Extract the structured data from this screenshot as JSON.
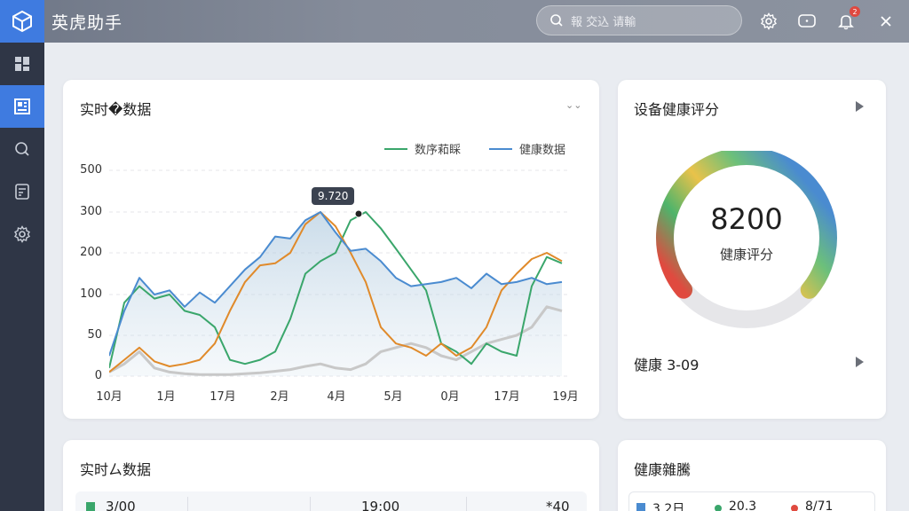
{
  "app": {
    "title": "英虎助手"
  },
  "search": {
    "placeholder": "報  交込 请輸"
  },
  "topbar": {
    "notification_count": "2"
  },
  "sidebar": {
    "items": [
      {
        "name": "dashboard",
        "icon": "grid-icon",
        "active": false
      },
      {
        "name": "reports",
        "icon": "board-icon",
        "active": true
      },
      {
        "name": "search",
        "icon": "search-icon",
        "active": false
      },
      {
        "name": "documents",
        "icon": "document-icon",
        "active": false
      },
      {
        "name": "settings",
        "icon": "gear-icon",
        "active": false
      }
    ]
  },
  "realtime_card": {
    "title": "实时�数据",
    "legend": [
      {
        "label": "数序萂睬",
        "color": "#3aa66b"
      },
      {
        "label": "健康数据",
        "color": "#4a8bd0"
      }
    ],
    "tooltip": "9.720"
  },
  "chart_data": {
    "type": "line",
    "x_ticks": [
      "10月",
      "1月",
      "17月",
      "2月",
      "4月",
      "5月",
      "0月",
      "17月",
      "19月"
    ],
    "y_ticks": [
      "500",
      "300",
      "200",
      "100",
      "50",
      "0"
    ],
    "ylim": [
      0,
      500
    ],
    "series": [
      {
        "name": "数序萂睬",
        "color": "#3aa66b",
        "values": [
          10,
          90,
          120,
          95,
          100,
          80,
          75,
          60,
          20,
          15,
          20,
          30,
          70,
          150,
          180,
          200,
          280,
          300,
          260,
          210,
          160,
          110,
          40,
          30,
          15,
          40,
          30,
          25,
          120,
          190,
          175
        ]
      },
      {
        "name": "健康数据",
        "color": "#4a8bd0",
        "values": [
          25,
          80,
          140,
          100,
          110,
          85,
          105,
          90,
          120,
          160,
          190,
          240,
          235,
          280,
          300,
          250,
          205,
          210,
          180,
          140,
          120,
          125,
          130,
          140,
          115,
          150,
          125,
          130,
          140,
          125,
          130
        ]
      },
      {
        "name": "",
        "color": "#e08a2a",
        "values": [
          5,
          20,
          35,
          18,
          12,
          15,
          20,
          40,
          80,
          130,
          170,
          175,
          200,
          270,
          300,
          265,
          200,
          130,
          60,
          40,
          35,
          25,
          40,
          25,
          35,
          60,
          110,
          150,
          185,
          200,
          180
        ]
      },
      {
        "name": "",
        "color": "#c8c8c8",
        "values": [
          5,
          15,
          30,
          10,
          5,
          3,
          2,
          2,
          2,
          3,
          4,
          6,
          8,
          12,
          15,
          10,
          8,
          15,
          30,
          35,
          40,
          35,
          25,
          20,
          30,
          40,
          45,
          50,
          60,
          85,
          80
        ]
      }
    ]
  },
  "health_card": {
    "title": "设备健康评分",
    "score": "8200",
    "score_label": "健康评分",
    "gauge_fraction": 0.72,
    "footer_label": "健康 3-09"
  },
  "bottom_left_card": {
    "title": "实时ㄙ数据",
    "cells": [
      "3/00",
      "19:00",
      "*40"
    ]
  },
  "bottom_right_card": {
    "title": "健康雜騰",
    "cells": [
      "3.2日",
      "20.3",
      "8/71"
    ]
  }
}
